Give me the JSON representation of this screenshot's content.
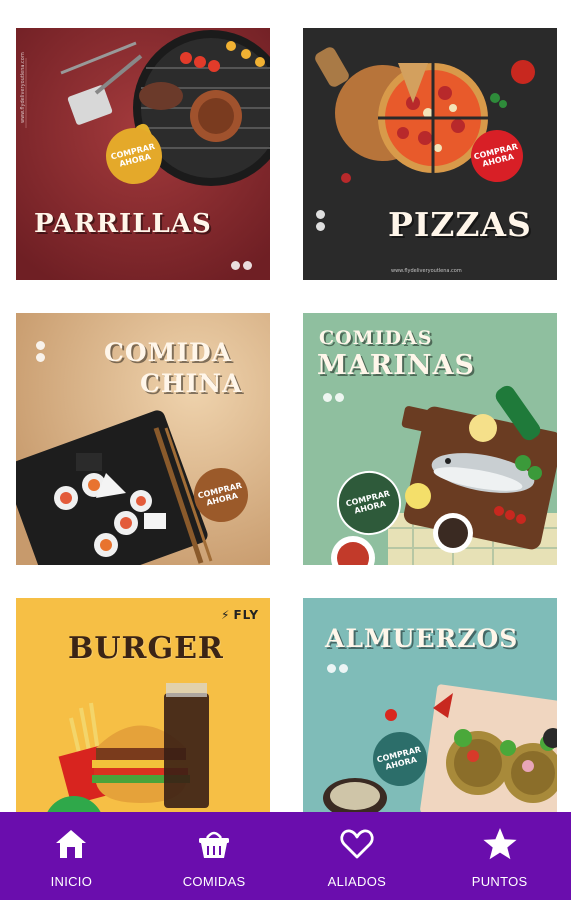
{
  "cards": {
    "parrillas": {
      "title": "PARRILLAS",
      "cta": "COMPRAR AHORA",
      "url": "www.flydeliveryoutlena.com",
      "bg": "#8b2a2f"
    },
    "pizzas": {
      "title": "PIZZAS",
      "cta": "COMPRAR AHORA",
      "url": "www.flydeliveryoutlena.com",
      "bg": "#262626"
    },
    "china": {
      "title_line1": "COMIDA",
      "title_line2": "CHINA",
      "cta": "COMPRAR AHORA",
      "bg": "#d9b48c"
    },
    "marinas": {
      "title_line1": "COMIDAS",
      "title_line2": "MARINAS",
      "cta": "COMPRAR AHORA",
      "bg": "#8fbf9f"
    },
    "burger": {
      "title": "BURGER",
      "brand": "FLY",
      "bg": "#f6bf45"
    },
    "almuerzos": {
      "title": "ALMUERZOS",
      "cta": "COMPRAR AHORA",
      "bg": "#7fbcb8"
    }
  },
  "nav": {
    "items": [
      {
        "label": "INICIO",
        "icon": "home-icon"
      },
      {
        "label": "COMIDAS",
        "icon": "basket-icon"
      },
      {
        "label": "ALIADOS",
        "icon": "heart-icon"
      },
      {
        "label": "PUNTOS",
        "icon": "star-icon"
      }
    ],
    "color": "#6a0dad"
  }
}
